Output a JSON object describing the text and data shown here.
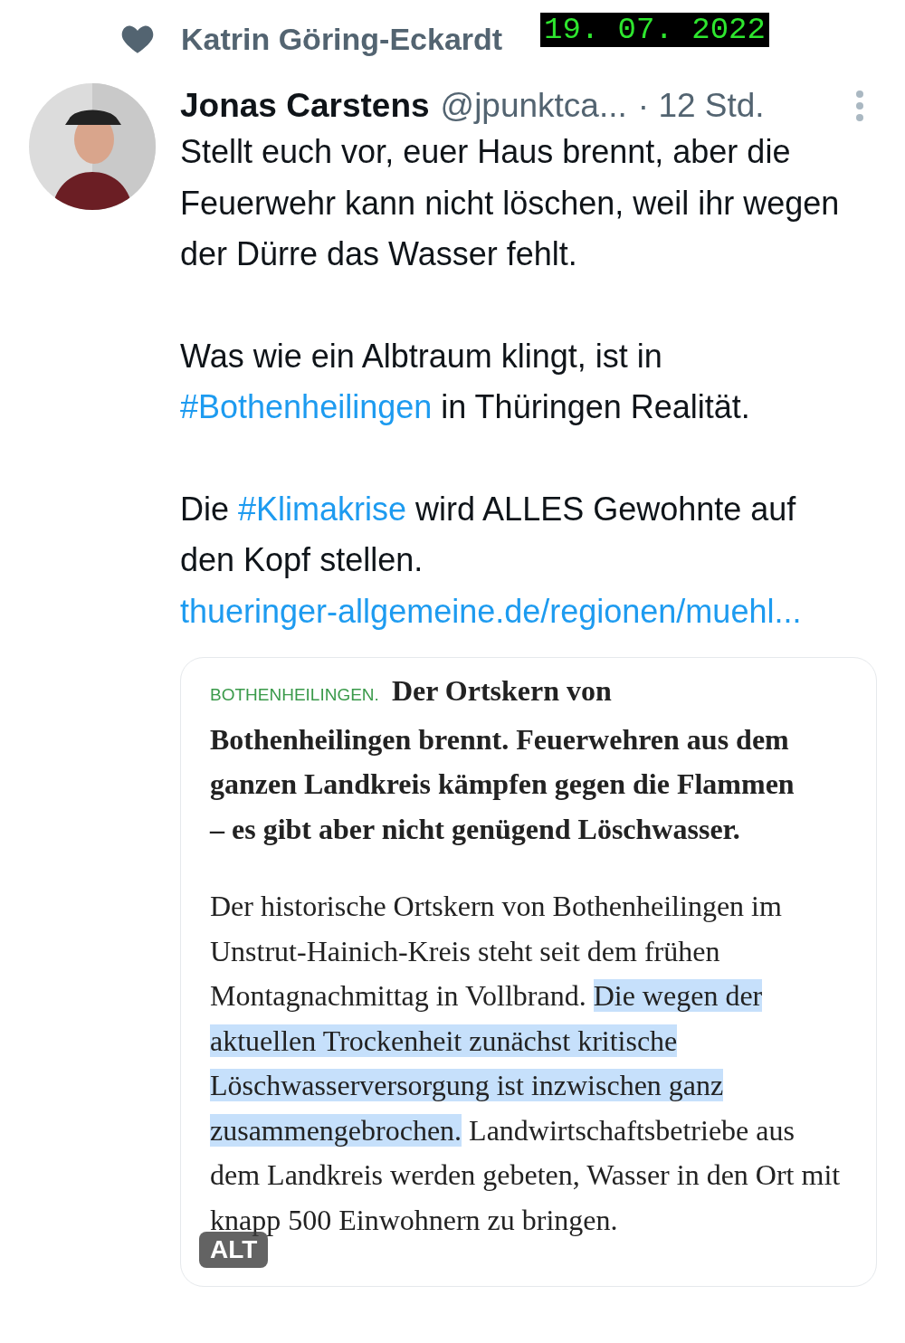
{
  "liked_by": {
    "text": "Katrin Göring-Eckardt"
  },
  "stamp": {
    "text": "19. 07. 2022"
  },
  "tweet": {
    "name": "Jonas Carstens",
    "handle": "@jpunktca...",
    "time": "· 12 Std.",
    "paragraphs": [
      [
        {
          "kind": "text",
          "text": "Stellt euch vor, euer Haus brennt, aber die Feuerwehr kann nicht löschen, weil ihr wegen der Dürre das Wasser fehlt."
        }
      ],
      [
        {
          "kind": "text",
          "text": "Was wie ein Albtraum klingt, ist in "
        },
        {
          "kind": "hashtag",
          "text": "#Bothenheilingen"
        },
        {
          "kind": "text",
          "text": " in Thüringen Realität."
        }
      ],
      [
        {
          "kind": "text",
          "text": "Die "
        },
        {
          "kind": "hashtag",
          "text": "#Klimakrise"
        },
        {
          "kind": "text",
          "text": " wird ALLES Gewohnte auf den Kopf stellen."
        },
        {
          "kind": "link",
          "text": "thueringer-allgemeine.de/regionen/muehl..."
        }
      ]
    ]
  },
  "article": {
    "kicker": "BOTHENHEILINGEN.",
    "lead": "Der Ortskern von Bothenheilingen brennt. Feuerwehren aus dem ganzen Landkreis kämpfen gegen die Flammen – es gibt aber nicht genügend Löschwasser.",
    "body": {
      "before": "Der historische Ortskern von Bothenheilingen im Unstrut-Hainich-Kreis steht seit dem frühen Montagnachmittag in Vollbrand. ",
      "selected": "Die wegen der aktuellen Trockenheit zunächst kritische Löschwasserversorgung ist inzwischen ganz zusammengebrochen.",
      "after": " Landwirtschaftsbetriebe aus dem Landkreis werden gebeten, Wasser in den Ort mit knapp 500 Einwohnern zu bringen."
    },
    "badge": "ALT"
  }
}
